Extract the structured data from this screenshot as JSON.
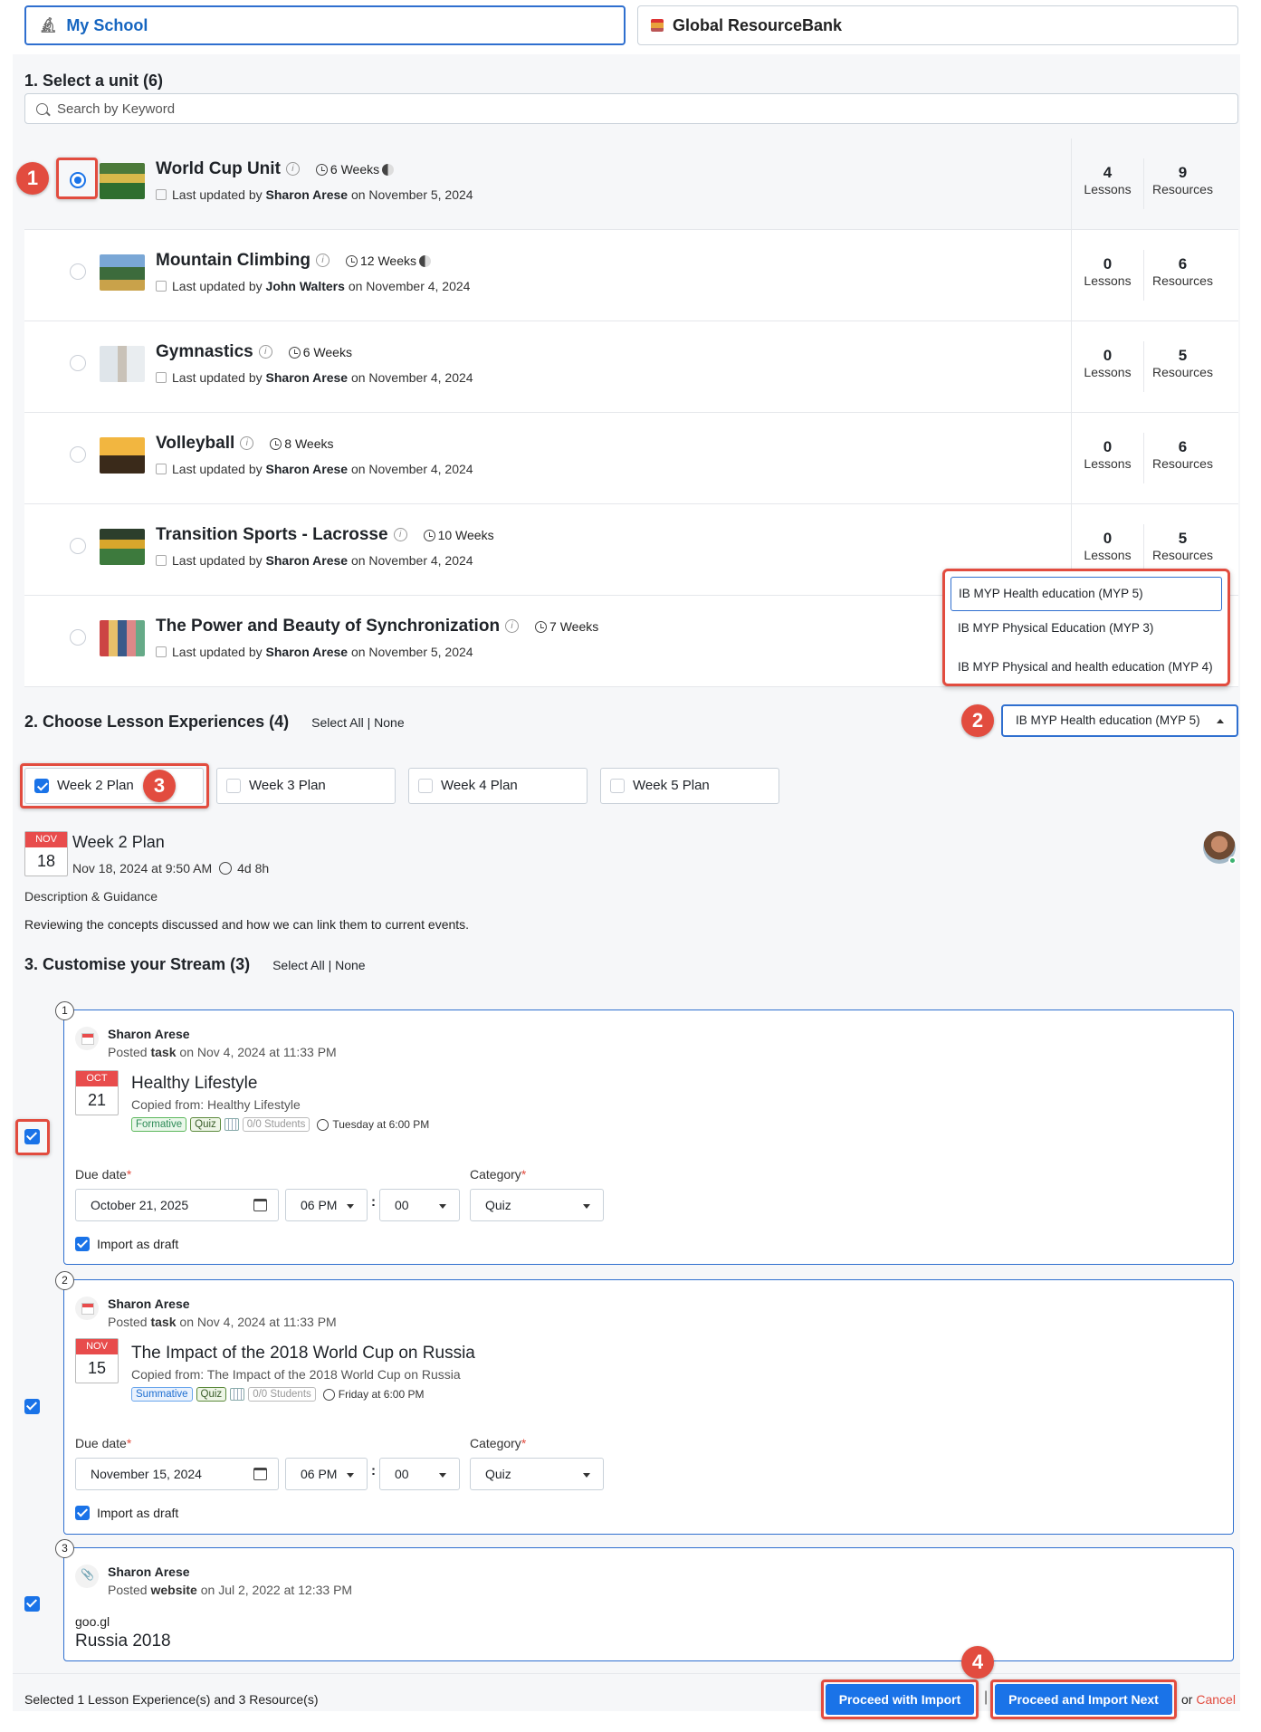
{
  "tabs": [
    {
      "label": "My School",
      "icon": "microscope-icon"
    },
    {
      "label": "Global ResourceBank",
      "icon": "resource-bank-icon"
    }
  ],
  "section1": {
    "title": "1. Select a unit (6)",
    "search_placeholder": "Search by Keyword"
  },
  "units": [
    {
      "title": "World Cup Unit",
      "weeks": "6 Weeks",
      "updated_prefix": "Last updated by",
      "author": "Sharon Arese",
      "date": "on November 5, 2024",
      "lessons": "4",
      "resources": "9",
      "lessons_label": "Lessons",
      "resources_label": "Resources",
      "selected": true
    },
    {
      "title": "Mountain Climbing",
      "weeks": "12 Weeks",
      "updated_prefix": "Last updated by",
      "author": "John Walters",
      "date": "on November 4, 2024",
      "lessons": "0",
      "resources": "6",
      "lessons_label": "Lessons",
      "resources_label": "Resources"
    },
    {
      "title": "Gymnastics",
      "weeks": "6 Weeks",
      "updated_prefix": "Last updated by",
      "author": "Sharon Arese",
      "date": "on November 4, 2024",
      "lessons": "0",
      "resources": "5",
      "lessons_label": "Lessons",
      "resources_label": "Resources"
    },
    {
      "title": "Volleyball",
      "weeks": "8 Weeks",
      "updated_prefix": "Last updated by",
      "author": "Sharon Arese",
      "date": "on November 4, 2024",
      "lessons": "0",
      "resources": "6",
      "lessons_label": "Lessons",
      "resources_label": "Resources"
    },
    {
      "title": "Transition Sports - Lacrosse",
      "weeks": "10 Weeks",
      "updated_prefix": "Last updated by",
      "author": "Sharon Arese",
      "date": "on November 4, 2024",
      "lessons": "0",
      "resources": "5",
      "lessons_label": "Lessons",
      "resources_label": "Resources"
    },
    {
      "title": "The Power and Beauty of Synchronization",
      "weeks": "7 Weeks",
      "updated_prefix": "Last updated by",
      "author": "Sharon Arese",
      "date": "on November 5, 2024"
    }
  ],
  "course_dropdown": {
    "selected": "IB MYP Health education (MYP 5)",
    "options": [
      "IB MYP Health education (MYP 5)",
      "IB MYP Physical Education (MYP 3)",
      "IB MYP Physical and health education (MYP 4)"
    ]
  },
  "section2": {
    "title": "2. Choose Lesson Experiences (4)",
    "select_all": "Select All",
    "separator": "|",
    "none": "None"
  },
  "week_tabs": [
    {
      "label": "Week 2 Plan",
      "checked": true
    },
    {
      "label": "Week 3 Plan",
      "checked": false
    },
    {
      "label": "Week 4 Plan",
      "checked": false
    },
    {
      "label": "Week 5 Plan",
      "checked": false
    }
  ],
  "plan": {
    "month": "NOV",
    "day": "18",
    "title": "Week 2 Plan",
    "datetime": "Nov 18, 2024 at 9:50 AM",
    "duration": "4d 8h",
    "description_heading": "Description & Guidance",
    "description": "Reviewing the concepts discussed and how we can link them to current events."
  },
  "section3": {
    "title": "3. Customise your Stream (3)",
    "select_all": "Select All",
    "separator": "|",
    "none": "None"
  },
  "stream": [
    {
      "number": "1",
      "author": "Sharon Arese",
      "posted_prefix": "Posted",
      "type": "task",
      "posted_suffix": "on Nov 4, 2024 at 11:33 PM",
      "month": "OCT",
      "day": "21",
      "title": "Healthy Lifestyle",
      "copied": "Copied from: Healthy Lifestyle",
      "tag1": "Formative",
      "tag2": "Quiz",
      "students": "0/0 Students",
      "due_text": "Tuesday at 6:00 PM",
      "due_label": "Due date",
      "category_label": "Category",
      "required_mark": "*",
      "due_date": "October 21, 2025",
      "hour": "06 PM",
      "minute": "00",
      "category": "Quiz",
      "draft_label": "Import as draft",
      "checked": true
    },
    {
      "number": "2",
      "author": "Sharon Arese",
      "posted_prefix": "Posted",
      "type": "task",
      "posted_suffix": "on Nov 4, 2024 at 11:33 PM",
      "month": "NOV",
      "day": "15",
      "title": "The Impact of the 2018 World Cup on Russia",
      "copied": "Copied from: The Impact of the 2018 World Cup on Russia",
      "tag1": "Summative",
      "tag2": "Quiz",
      "students": "0/0 Students",
      "due_text": "Friday at 6:00 PM",
      "due_label": "Due date",
      "category_label": "Category",
      "required_mark": "*",
      "due_date": "November 15, 2024",
      "hour": "06 PM",
      "minute": "00",
      "category": "Quiz",
      "draft_label": "Import as draft",
      "checked": true
    },
    {
      "number": "3",
      "author": "Sharon Arese",
      "posted_prefix": "Posted",
      "type": "website",
      "posted_suffix": "on Jul 2, 2022 at 12:33 PM",
      "domain": "goo.gl",
      "title": "Russia 2018",
      "checked": true
    }
  ],
  "footer": {
    "summary": "Selected 1 Lesson Experience(s) and 3 Resource(s)",
    "proceed": "Proceed with Import",
    "separator": "|",
    "proceed_next": "Proceed and Import Next",
    "or": "or",
    "cancel": "Cancel"
  },
  "annotations": [
    "1",
    "2",
    "3",
    "4"
  ],
  "colors": {
    "accent": "#1a73e8",
    "highlight": "#e24c3f",
    "date_header": "#e84c4c"
  }
}
